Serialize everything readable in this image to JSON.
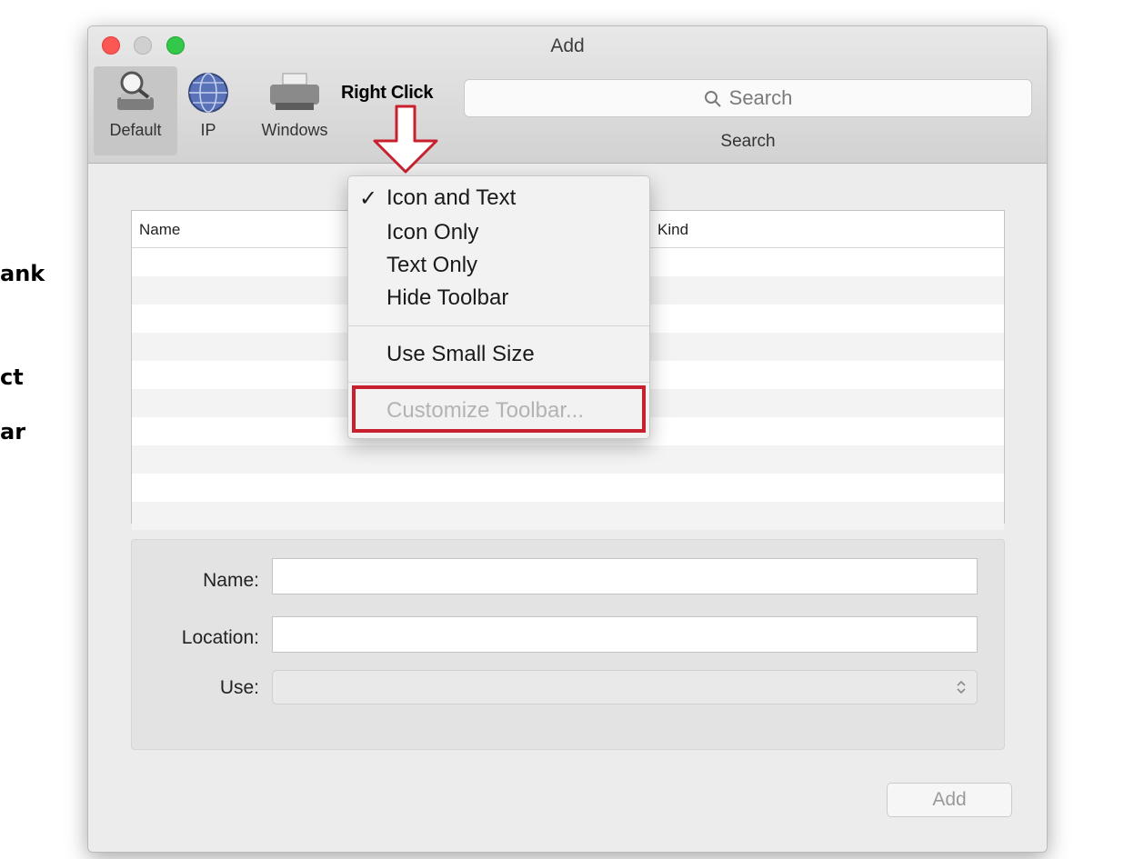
{
  "side_notes": [
    "ank",
    "ct",
    "ar"
  ],
  "window": {
    "title": "Add",
    "colors": {
      "close": "#fc5753",
      "minimize": "#d0d0d0",
      "zoom": "#34c84a"
    }
  },
  "toolbar": {
    "items": [
      {
        "label": "Default",
        "icon": "magnifier-printer-icon",
        "selected": true
      },
      {
        "label": "IP",
        "icon": "globe-icon",
        "selected": false
      },
      {
        "label": "Windows",
        "icon": "printer-icon",
        "selected": false
      }
    ],
    "annotation": "Right Click",
    "search": {
      "placeholder": "Search",
      "caption": "Search"
    }
  },
  "table": {
    "columns": [
      "Name",
      "Kind"
    ],
    "rows": []
  },
  "form": {
    "name_label": "Name:",
    "location_label": "Location:",
    "use_label": "Use:",
    "name_value": "",
    "location_value": "",
    "use_value": ""
  },
  "add_button": "Add",
  "context_menu": {
    "items": [
      {
        "label": "Icon and Text",
        "checked": true,
        "enabled": true
      },
      {
        "label": "Icon Only",
        "checked": false,
        "enabled": true
      },
      {
        "label": "Text Only",
        "checked": false,
        "enabled": true
      },
      {
        "label": "Hide Toolbar",
        "checked": false,
        "enabled": true
      },
      {
        "label": "Use Small Size",
        "checked": false,
        "enabled": true
      },
      {
        "label": "Customize Toolbar...",
        "checked": false,
        "enabled": false,
        "highlighted": true
      }
    ],
    "check_glyph": "✓",
    "highlight_color": "#c8202f"
  }
}
